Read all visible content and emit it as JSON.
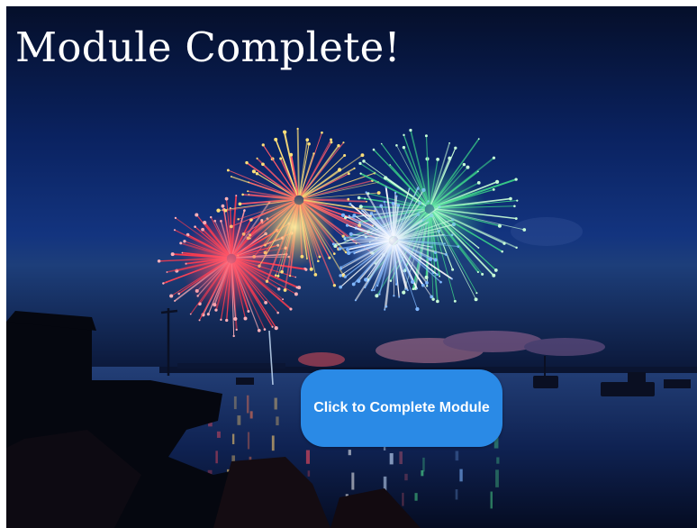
{
  "slide": {
    "title": "Module Complete!"
  },
  "complete_button": {
    "label": "Click to Complete Module",
    "color": "#2a8ae6"
  },
  "background": {
    "sky_color": "#0b2770",
    "firework_colors": [
      "#ff3b4e",
      "#3cd68a",
      "#ffe07a",
      "#ffffff",
      "#7fb7ff"
    ]
  }
}
